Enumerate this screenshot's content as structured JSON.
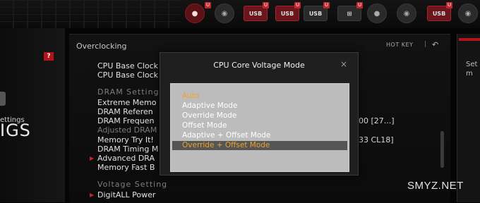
{
  "header": {
    "usb_label": "USB",
    "u_badge": "U"
  },
  "sidebar": {
    "badge": "?",
    "small_label": "ettings",
    "big_label": "IGS"
  },
  "panel": {
    "title": "Overclocking",
    "hotkey": "HOT KEY",
    "hotkey_separator": "|",
    "back_icon": "↶"
  },
  "settings": [
    {
      "label": "CPU Base Clock"
    },
    {
      "label": "CPU Base Clock"
    },
    {
      "label": "DRAM Setting",
      "section": true
    },
    {
      "label": "Extreme Memo"
    },
    {
      "label": "DRAM Referen"
    },
    {
      "label": "DRAM Frequen"
    },
    {
      "label": "Adjusted DRAM",
      "dim": true
    },
    {
      "label": "Memory Try It!"
    },
    {
      "label": "DRAM Timing M"
    },
    {
      "label": "Advanced DRA",
      "arrow": true
    },
    {
      "label": "Memory Fast B"
    },
    {
      "label": "Voltage Setting",
      "section": true
    },
    {
      "label": "DigitALL Power",
      "arrow": true
    }
  ],
  "right_values": {
    "dram_frequency": "00 [27...]",
    "memory_try_it": "33 CL18]"
  },
  "help": {
    "text": "Set",
    "text2": "m"
  },
  "modal": {
    "title": "CPU Core Voltage Mode",
    "close": "×",
    "options": [
      "Auto",
      "Adaptive Mode",
      "Override Mode",
      "Offset Mode",
      "Adaptive + Offset Mode",
      "Override + Offset Mode"
    ],
    "current_value": "Auto",
    "highlighted": "Override + Offset Mode"
  },
  "watermark": "SMYZ.NET",
  "colors": {
    "accent_red": "#b5121b",
    "option_active": "#f0a22a",
    "list_bg": "#bcbcbc"
  }
}
